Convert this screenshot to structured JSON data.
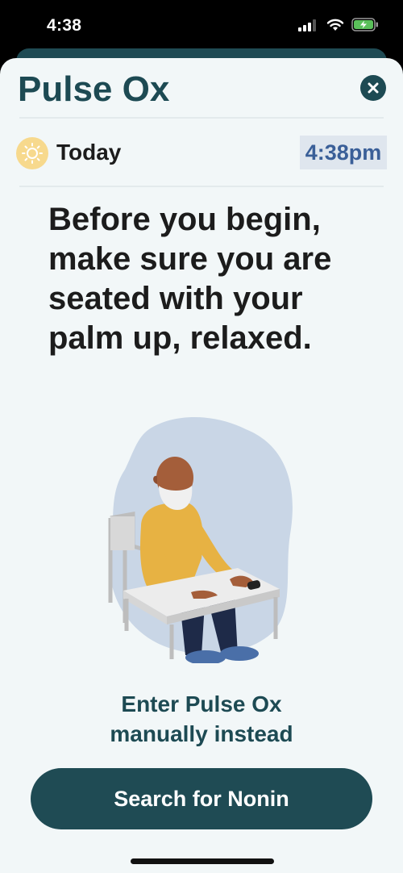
{
  "status_bar": {
    "time": "4:38"
  },
  "header": {
    "title": "Pulse Ox",
    "close_icon": "close-icon"
  },
  "session": {
    "day": "Today",
    "time": "4:38pm",
    "day_icon": "sun-icon"
  },
  "instruction": {
    "text": "Before you begin, make sure you are seated with your palm up, relaxed."
  },
  "actions": {
    "manual_link_line1": "Enter Pulse Ox",
    "manual_link_line2": "manually instead",
    "primary_button": "Search for Nonin"
  },
  "colors": {
    "brand": "#1d4a53",
    "sheet_background": "#f2f7f8",
    "time_badge_text": "#3a5f98",
    "sun": "#f7d98d",
    "battery": "#5ac05a"
  }
}
